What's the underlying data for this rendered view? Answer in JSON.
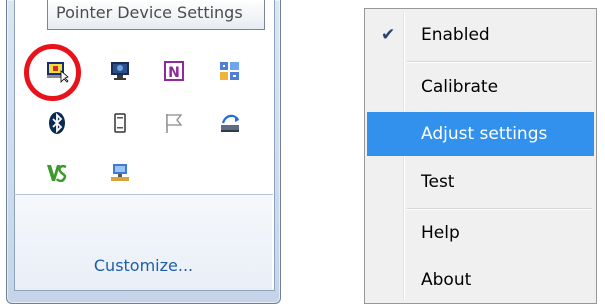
{
  "flyout": {
    "tooltip": "Pointer Device Settings",
    "customize_label": "Customize...",
    "icons": [
      "pointer-device-settings-icon",
      "network-monitor-icon",
      "onenote-icon",
      "grid-app-icon",
      "bluetooth-icon",
      "device-icon",
      "action-center-flag-icon",
      "eject-drive-icon",
      "vs-icon",
      "computer-network-icon"
    ]
  },
  "menu": {
    "items": [
      {
        "label": "Enabled",
        "checked": true
      },
      {
        "label": "Calibrate"
      },
      {
        "label": "Adjust settings",
        "selected": true
      },
      {
        "label": "Test"
      },
      {
        "label": "Help"
      },
      {
        "label": "About"
      }
    ],
    "check_glyph": "✔"
  },
  "colors": {
    "highlight_circle": "#e8131a",
    "selected_item": "#3391ee",
    "link": "#1d5fa8"
  }
}
